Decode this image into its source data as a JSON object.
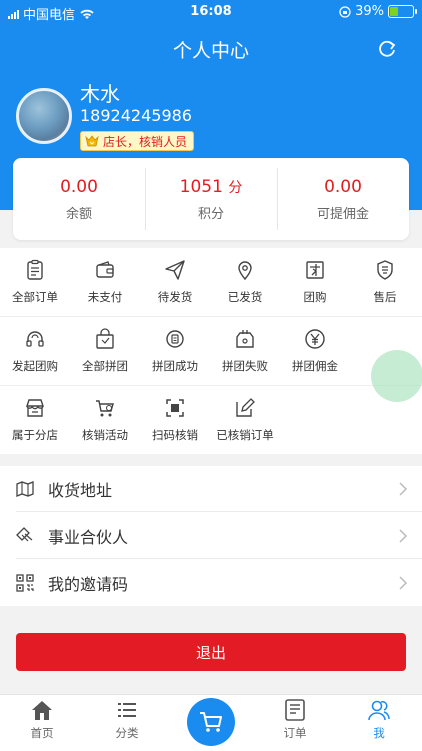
{
  "status_bar": {
    "carrier": "中国电信",
    "time": "16:08",
    "battery_percent": "39%",
    "battery_level": 0.39
  },
  "header": {
    "title": "个人中心"
  },
  "profile": {
    "name": "木水",
    "phone": "18924245986",
    "role_badge": "店长，核销人员"
  },
  "stats": [
    {
      "value": "0.00",
      "unit": "",
      "label": "余额"
    },
    {
      "value": "1051",
      "unit": "分",
      "label": "积分"
    },
    {
      "value": "0.00",
      "unit": "",
      "label": "可提佣金"
    }
  ],
  "grid": {
    "row1": [
      {
        "label": "全部订单",
        "icon": "clipboard-icon"
      },
      {
        "label": "未支付",
        "icon": "wallet-icon"
      },
      {
        "label": "待发货",
        "icon": "send-icon"
      },
      {
        "label": "已发货",
        "icon": "location-pin-icon"
      },
      {
        "label": "团购",
        "icon": "group-buy-icon"
      },
      {
        "label": "售后",
        "icon": "after-sale-icon"
      }
    ],
    "row2": [
      {
        "label": "发起团购",
        "icon": "headset-icon"
      },
      {
        "label": "全部拼团",
        "icon": "shopping-bag-icon"
      },
      {
        "label": "拼团成功",
        "icon": "coin-icon"
      },
      {
        "label": "拼团失败",
        "icon": "tag-icon"
      },
      {
        "label": "拼团佣金",
        "icon": "yen-icon"
      }
    ],
    "row3": [
      {
        "label": "属于分店",
        "icon": "store-icon"
      },
      {
        "label": "核销活动",
        "icon": "cart-icon"
      },
      {
        "label": "扫码核销",
        "icon": "scan-icon"
      },
      {
        "label": "已核销订单",
        "icon": "edit-icon"
      }
    ]
  },
  "menu": [
    {
      "label": "收货地址",
      "icon": "map-icon"
    },
    {
      "label": "事业合伙人",
      "icon": "handshake-icon"
    },
    {
      "label": "我的邀请码",
      "icon": "qrcode-icon"
    }
  ],
  "logout_label": "退出",
  "tabs": [
    {
      "label": "首页",
      "icon": "home-icon"
    },
    {
      "label": "分类",
      "icon": "list-icon"
    },
    {
      "label": "",
      "icon": "cart-icon"
    },
    {
      "label": "订单",
      "icon": "order-icon"
    },
    {
      "label": "我",
      "icon": "user-icon"
    }
  ],
  "colors": {
    "primary": "#1a8cf0",
    "danger": "#e31b25",
    "value_red": "#e02020"
  }
}
